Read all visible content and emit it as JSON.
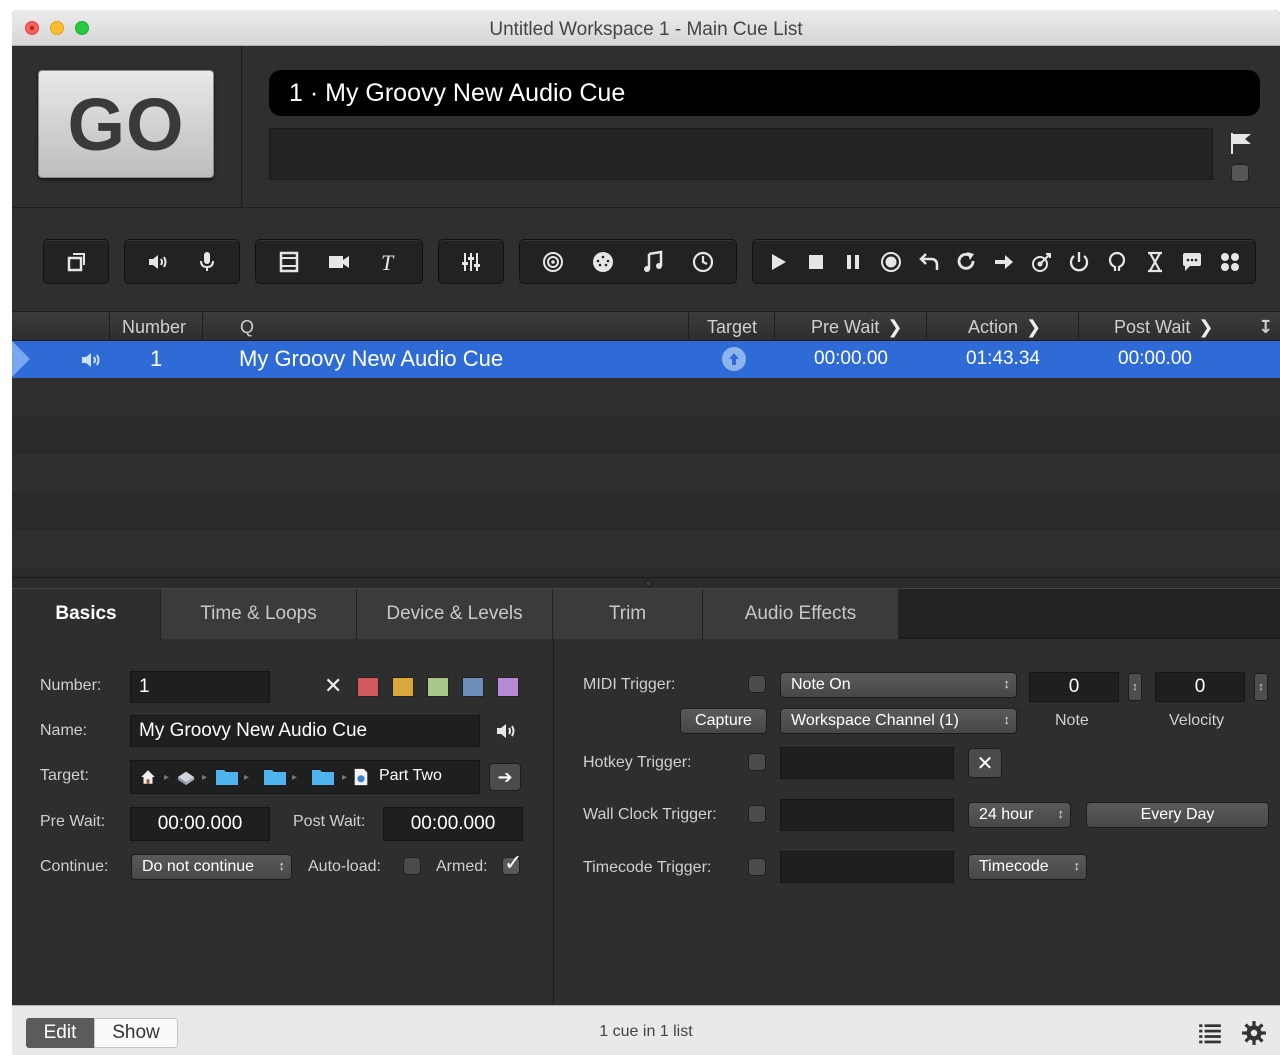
{
  "window": {
    "title": "Untitled Workspace 1 - Main Cue List"
  },
  "go": {
    "label": "GO"
  },
  "standby": {
    "cue_title": "1 · My Groovy New Audio Cue",
    "notes": ""
  },
  "toolbar_groups": [
    {
      "name": "group",
      "icons": [
        "group-icon"
      ]
    },
    {
      "name": "audio",
      "icons": [
        "audio-icon",
        "mic-icon"
      ]
    },
    {
      "name": "video",
      "icons": [
        "video-icon",
        "camera-icon",
        "text-icon"
      ]
    },
    {
      "name": "fade",
      "icons": [
        "fade-icon"
      ]
    },
    {
      "name": "network",
      "icons": [
        "network-icon",
        "midi-icon",
        "music-icon",
        "timecode-icon"
      ]
    },
    {
      "name": "control",
      "icons": [
        "start-icon",
        "stop-icon",
        "pause-icon",
        "load-icon",
        "reset-icon",
        "devamp-icon",
        "goto-icon",
        "target-icon",
        "arm-icon",
        "disarm-icon",
        "wait-icon",
        "memo-icon",
        "script-icon"
      ]
    }
  ],
  "cue_list": {
    "headers": {
      "number": "Number",
      "q": "Q",
      "target": "Target",
      "pre_wait": "Pre Wait",
      "action": "Action",
      "post_wait": "Post Wait"
    },
    "rows": [
      {
        "number": "1",
        "name": "My Groovy New Audio Cue",
        "pre_wait": "00:00.00",
        "action": "01:43.34",
        "post_wait": "00:00.00",
        "icon": "audio-icon"
      }
    ]
  },
  "tabs": [
    "Basics",
    "Time & Loops",
    "Device & Levels",
    "Trim",
    "Audio Effects"
  ],
  "basics": {
    "number_label": "Number:",
    "number_value": "1",
    "name_label": "Name:",
    "name_value": "My Groovy New Audio Cue",
    "target_label": "Target:",
    "target_value": "Part Two",
    "pre_wait_label": "Pre Wait:",
    "pre_wait_value": "00:00.000",
    "post_wait_label": "Post Wait:",
    "post_wait_value": "00:00.000",
    "continue_label": "Continue:",
    "continue_value": "Do not continue",
    "autoload_label": "Auto-load:",
    "armed_label": "Armed:",
    "colors": [
      "#d25a5a",
      "#d9a83b",
      "#a9c98a",
      "#6c8fb9",
      "#b58ad6"
    ]
  },
  "triggers": {
    "midi_label": "MIDI Trigger:",
    "midi_type": "Note On",
    "note_value": "0",
    "note_label": "Note",
    "velocity_value": "0",
    "velocity_label": "Velocity",
    "capture_label": "Capture",
    "channel_value": "Workspace Channel (1)",
    "hotkey_label": "Hotkey Trigger:",
    "wallclock_label": "Wall Clock Trigger:",
    "hour_mode": "24 hour",
    "every_day": "Every Day",
    "timecode_label": "Timecode Trigger:",
    "timecode_value": "Timecode"
  },
  "status": {
    "edit": "Edit",
    "show": "Show",
    "summary": "1 cue in 1 list"
  }
}
